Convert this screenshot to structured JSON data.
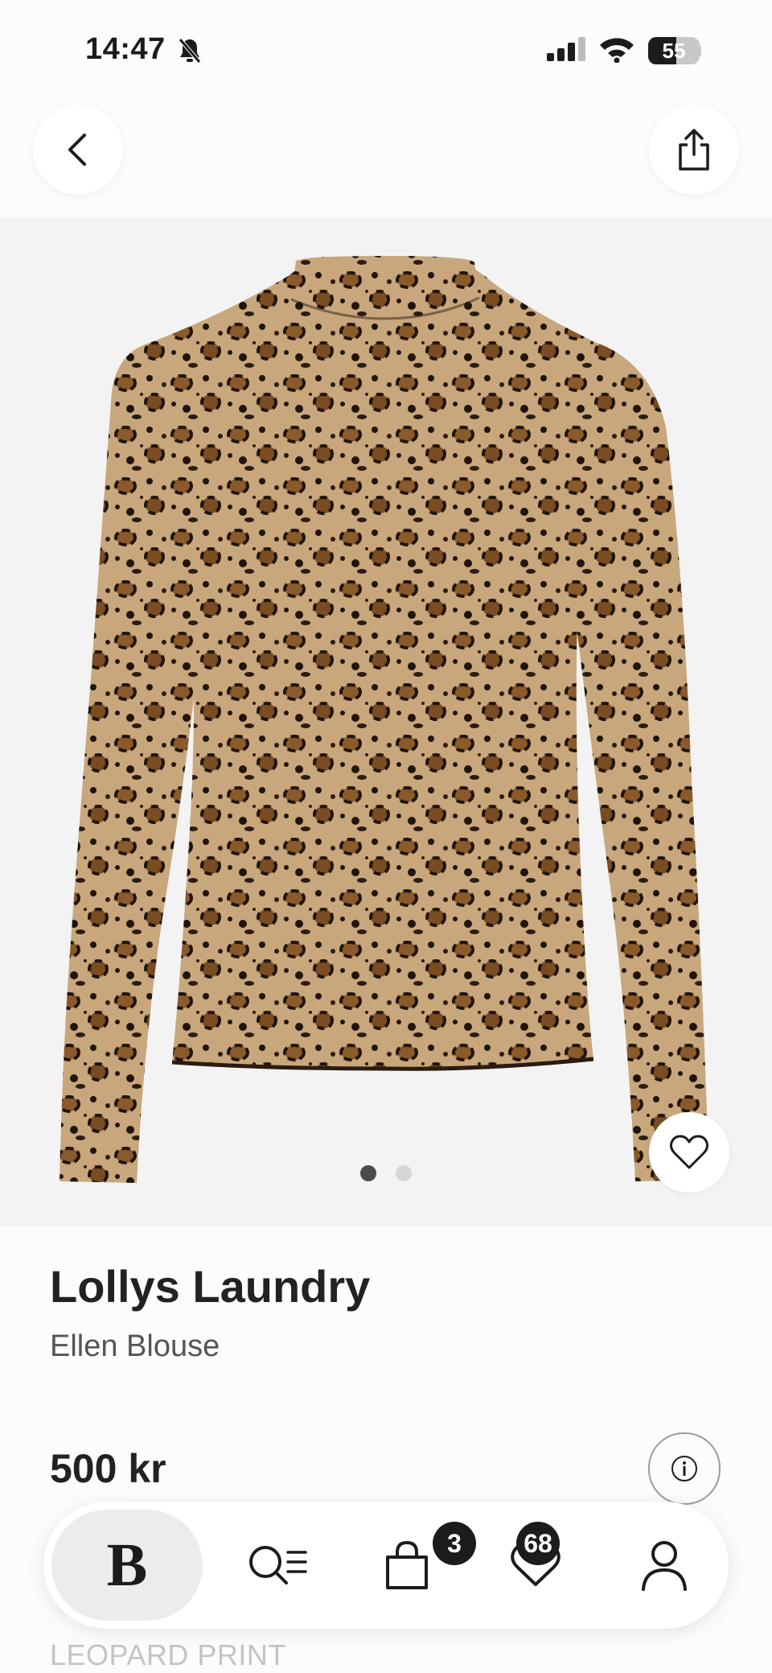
{
  "status_bar": {
    "time": "14:47",
    "battery_level": "55",
    "battery_fraction": 0.55
  },
  "nav": {
    "back_icon": "chevron-left-icon",
    "share_icon": "share-icon"
  },
  "gallery": {
    "image_alt": "Leopard print long sleeve high neck blouse",
    "dot_count": 2,
    "active_dot": 0,
    "wishlist_icon": "heart-outline-icon"
  },
  "product": {
    "brand": "Lollys Laundry",
    "name": "Ellen Blouse",
    "price": "500 kr",
    "color": "LEOPARD PRINT",
    "info_icon": "info-icon"
  },
  "tabbar": {
    "home_logo": "B",
    "bag_count": "3",
    "wishlist_count": "68"
  },
  "colors": {
    "background": "#f3f3f3",
    "panel": "#fcfcfc",
    "text_primary": "#1c1c1e",
    "badge": "#1c1c1e"
  }
}
